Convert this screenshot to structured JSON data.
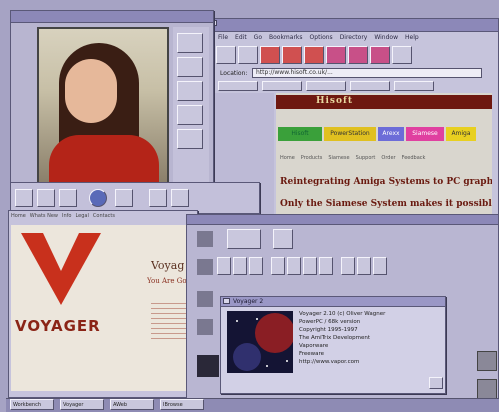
{
  "browser": {
    "menu": [
      "File",
      "Edit",
      "Go",
      "Bookmarks",
      "Options",
      "Directory",
      "Window",
      "Help"
    ],
    "location_label": "Location:",
    "location_value": "http://www.hisoft.co.uk/...",
    "nav_items": [
      "Hisoft",
      "PowerStation",
      "Arexx",
      "Siamese",
      "Amiga"
    ],
    "nav_colors": [
      "#3aa03a",
      "#e0c020",
      "#6c6cd8",
      "#e040a0",
      "#e8d020"
    ],
    "links_row": [
      "Home",
      "Products",
      "Siamese",
      "Support",
      "Order",
      "Feedback"
    ],
    "heading": "Reintegrating Amiga Systems to PC graphics",
    "subheading": "Only the Siamese System makes it possible"
  },
  "voyager": {
    "logo_text": "VOYAGER",
    "title": "Voyag",
    "subtitle": "You Are Go",
    "tabs": [
      "Home",
      "Whats New",
      "Info",
      "Legal",
      "Contacts"
    ]
  },
  "aboutdialog": {
    "title": "Voyager 2",
    "lines": [
      "Voyager 2.10 (c) Oliver Wagner",
      "PowerPC / 68k version",
      "Copyright 1995-1997",
      "The AmiTrix Development",
      "Vaporware",
      "Freeware",
      "http://www.vapor.com"
    ]
  },
  "taskbar": {
    "items": [
      "Workbench",
      "Voyager",
      "AWeb",
      "IBrowse"
    ]
  },
  "colors": {
    "desktop": "#a6a3c4",
    "accent_red": "#c8301c",
    "dialog_bg": "#d2d0e6"
  }
}
